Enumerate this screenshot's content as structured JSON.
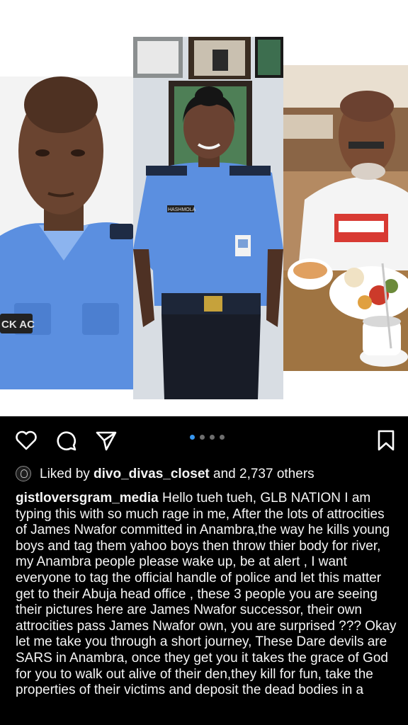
{
  "post": {
    "images": [
      {
        "name": "officer-portrait-left",
        "uniform_tag": "CK AC"
      },
      {
        "name": "female-officer-center",
        "badge_text": "HASHMOLA"
      },
      {
        "name": "man-dining-right"
      }
    ],
    "carousel": {
      "count": 4,
      "active_index": 0
    }
  },
  "actions": {
    "icons": [
      "heart-icon",
      "comment-icon",
      "share-icon",
      "bookmark-icon"
    ]
  },
  "likes": {
    "prefix": "Liked by ",
    "user": "divo_divas_closet",
    "suffix": " and 2,737 others"
  },
  "caption": {
    "username": "gistloversgram_media",
    "text": "Hello tueh tueh, GLB NATION I am typing this with so much rage in me, After the lots of attrocities of  James Nwafor committed in Anambra,the way he kills young boys and tag them yahoo boys then throw thier body for river, my Anambra people please wake up, be at alert , I want everyone to tag the official handle of police and let this matter get to their Abuja head office , these 3 people you are seeing their pictures here are James Nwafor successor, their own attrocities pass James Nwafor own, you are surprised ??? Okay let me take you through a short journey, These Dare devils are SARS in Anambra, once they get you it takes the grace of God for you to walk out alive of their den,they kill for fun, take the properties of their victims and deposit the dead bodies in a"
  },
  "colors": {
    "background": "#000000",
    "text": "#f5f5f5",
    "carousel_active": "#3797f0",
    "carousel_inactive": "#6e6e6e"
  }
}
